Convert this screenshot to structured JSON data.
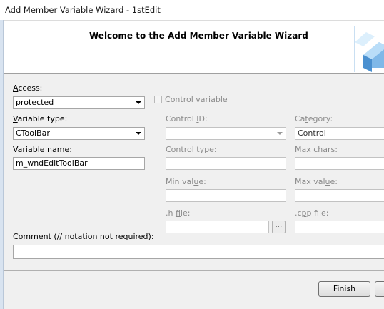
{
  "window": {
    "title": "Add Member Variable Wizard - 1stEdit"
  },
  "header": {
    "welcome": "Welcome to the Add Member Variable Wizard",
    "logo_icon": "wizard-cube-icon"
  },
  "form": {
    "access": {
      "label_key": "A",
      "label_rest": "ccess:",
      "value": "protected"
    },
    "control_variable": {
      "label_key": "C",
      "label_rest": "ontrol variable",
      "checked": false
    },
    "variable_type": {
      "label_key": "V",
      "label_rest": "ariable type:",
      "value": "CToolBar"
    },
    "variable_name": {
      "label_pre": "Variable ",
      "label_key": "n",
      "label_rest": "ame:",
      "value": "m_wndEditToolBar"
    },
    "control_id": {
      "label_pre": "Control ",
      "label_key": "I",
      "label_rest": "D:",
      "value": ""
    },
    "category": {
      "label_pre": "Ca",
      "label_key": "t",
      "label_rest": "egory:",
      "value": "Control"
    },
    "control_type": {
      "label_pre": "Control t",
      "label_key": "y",
      "label_rest": "pe:",
      "value": ""
    },
    "max_chars": {
      "label_pre": "Ma",
      "label_key": "x",
      "label_rest": " chars:",
      "value": ""
    },
    "min_value": {
      "label_pre": "Min val",
      "label_key": "u",
      "label_rest": "e:",
      "value": ""
    },
    "max_value": {
      "label_pre": "Max val",
      "label_key": "u",
      "label_rest": "e:",
      "value": ""
    },
    "h_file": {
      "label_pre": ".h ",
      "label_key": "f",
      "label_rest": "ile:",
      "value": "",
      "browse_label": "..."
    },
    "cpp_file": {
      "label_pre": ".c",
      "label_key": "p",
      "label_rest": "p file:",
      "value": ""
    },
    "comment": {
      "label_pre": "Co",
      "label_key": "m",
      "label_rest": "ment (// notation not required):",
      "value": ""
    }
  },
  "footer": {
    "finish_label": "Finish"
  }
}
